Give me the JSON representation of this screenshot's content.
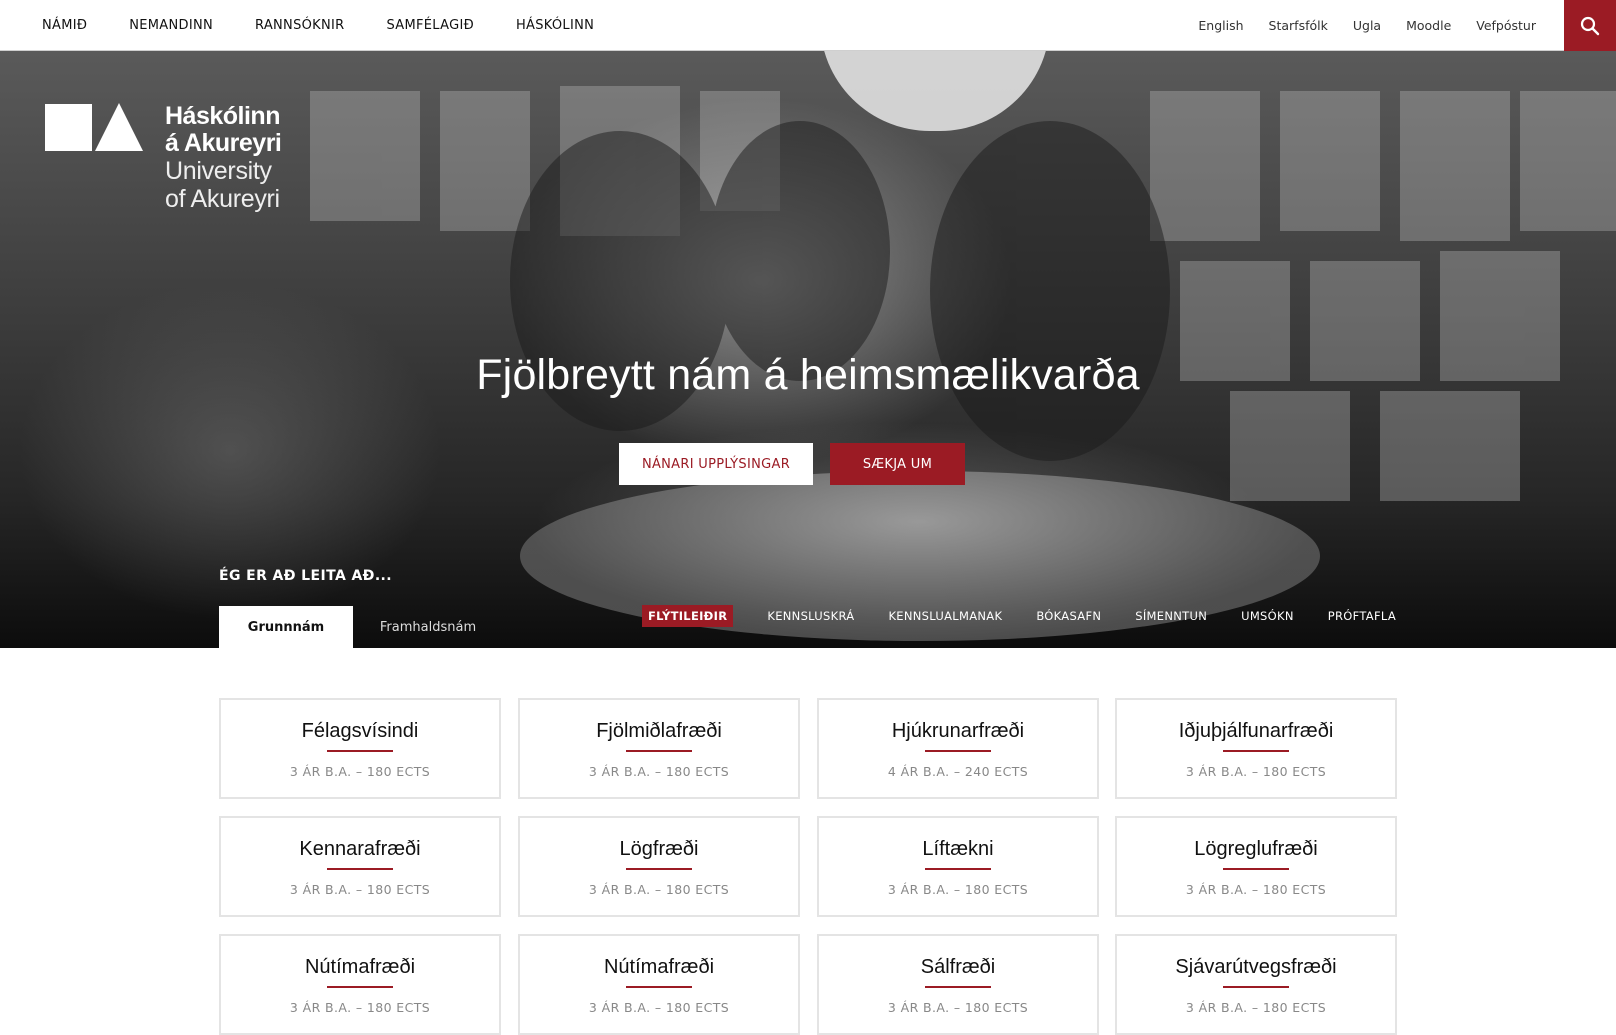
{
  "nav": {
    "main": [
      "NÁMIÐ",
      "NEMANDINN",
      "RANNSÓKNIR",
      "SAMFÉLAGIÐ",
      "HÁSKÓLINN"
    ],
    "util": [
      "English",
      "Starfsfólk",
      "Ugla",
      "Moodle",
      "Vefpóstur"
    ]
  },
  "logo": {
    "line1": "Háskólinn",
    "line2": "á Akureyri",
    "line3": "University",
    "line4": "of Akureyri"
  },
  "hero": {
    "title": "Fjölbreytt nám á heimsmælikvarða",
    "btn_info": "NÁNARI UPPLÝSINGAR",
    "btn_apply": "SÆKJA UM"
  },
  "search_section": {
    "label": "ÉG ER AÐ LEITA AÐ...",
    "tabs": [
      "Grunnnám",
      "Framhaldsnám"
    ],
    "quicklinks": [
      "FLÝTILEIÐIR",
      "KENNSLUSKRÁ",
      "KENNSLUALMANAK",
      "BÓKASAFN",
      "SÍMENNTUN",
      "UMSÓKN",
      "PRÓFTAFLA"
    ]
  },
  "programs": [
    {
      "name": "Félagsvísindi",
      "meta": "3 ÁR B.A. – 180 ECTS"
    },
    {
      "name": "Fjölmiðlafræði",
      "meta": "3 ÁR B.A. – 180 ECTS"
    },
    {
      "name": "Hjúkrunarfræði",
      "meta": "4 ÁR B.A. – 240 ECTS"
    },
    {
      "name": "Iðjuþjálfunarfræði",
      "meta": "3 ÁR B.A. – 180 ECTS"
    },
    {
      "name": "Kennarafræði",
      "meta": "3 ÁR B.A. – 180 ECTS"
    },
    {
      "name": "Lögfræði",
      "meta": "3 ÁR B.A. – 180 ECTS"
    },
    {
      "name": "Líftækni",
      "meta": "3 ÁR B.A. – 180 ECTS"
    },
    {
      "name": "Lögreglufræði",
      "meta": "3 ÁR B.A. – 180 ECTS"
    },
    {
      "name": "Nútímafræði",
      "meta": "3 ÁR B.A. – 180 ECTS"
    },
    {
      "name": "Nútímafræði",
      "meta": "3 ÁR B.A. – 180 ECTS"
    },
    {
      "name": "Sálfræði",
      "meta": "3 ÁR B.A. – 180 ECTS"
    },
    {
      "name": "Sjávarútvegsfræði",
      "meta": "3 ÁR B.A. – 180 ECTS"
    }
  ],
  "colors": {
    "accent": "#9b1b24",
    "card_border": "#e4e4e4"
  }
}
